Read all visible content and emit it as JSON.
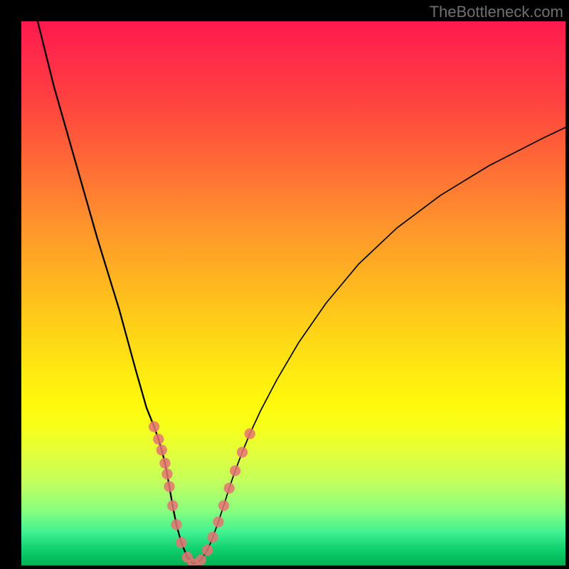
{
  "watermark": "TheBottleneck.com",
  "chart_data": {
    "type": "line",
    "title": "",
    "xlabel": "",
    "ylabel": "",
    "xlim": [
      0,
      100
    ],
    "ylim": [
      0,
      100
    ],
    "series": [
      {
        "name": "left-branch",
        "x": [
          3,
          6,
          10,
          14,
          18,
          21,
          23,
          24.4,
          25.2,
          25.8,
          26.4,
          26.8,
          27.2,
          27.8,
          28.5,
          29.4,
          30.5,
          31.6
        ],
        "y": [
          100,
          88,
          74,
          60,
          47,
          36,
          29,
          25.5,
          23.2,
          21.2,
          18.8,
          16.8,
          14.5,
          11,
          7.5,
          4.2,
          1.5,
          0.3
        ]
      },
      {
        "name": "right-branch",
        "x": [
          31.6,
          33,
          34.2,
          35.2,
          36.2,
          37.2,
          38.2,
          39.3,
          40.6,
          42,
          44,
          47,
          51,
          56,
          62,
          69,
          77,
          86,
          96,
          100
        ],
        "y": [
          0.3,
          1,
          2.8,
          5.2,
          8,
          11,
          14.2,
          17.4,
          20.8,
          24.2,
          28.5,
          34.2,
          41,
          48.2,
          55.4,
          62,
          68,
          73.5,
          78.6,
          80.5
        ]
      }
    ],
    "dots": {
      "left": [
        [
          24.4,
          25.5
        ],
        [
          25.2,
          23.2
        ],
        [
          25.8,
          21.2
        ],
        [
          26.4,
          18.8
        ],
        [
          26.8,
          16.8
        ],
        [
          27.2,
          14.5
        ],
        [
          27.8,
          11
        ],
        [
          28.5,
          7.5
        ],
        [
          29.4,
          4.2
        ],
        [
          30.5,
          1.5
        ],
        [
          31.6,
          0.3
        ]
      ],
      "right": [
        [
          33,
          1
        ],
        [
          34.2,
          2.8
        ],
        [
          35.2,
          5.2
        ],
        [
          36.2,
          8
        ],
        [
          37.2,
          11
        ],
        [
          38.2,
          14.2
        ],
        [
          39.3,
          17.4
        ],
        [
          40.6,
          20.8
        ],
        [
          42,
          24.2
        ]
      ]
    },
    "gradient_background": {
      "top_color": "#ff1a4d",
      "bottom_color": "#00b050",
      "orientation": "vertical"
    }
  }
}
